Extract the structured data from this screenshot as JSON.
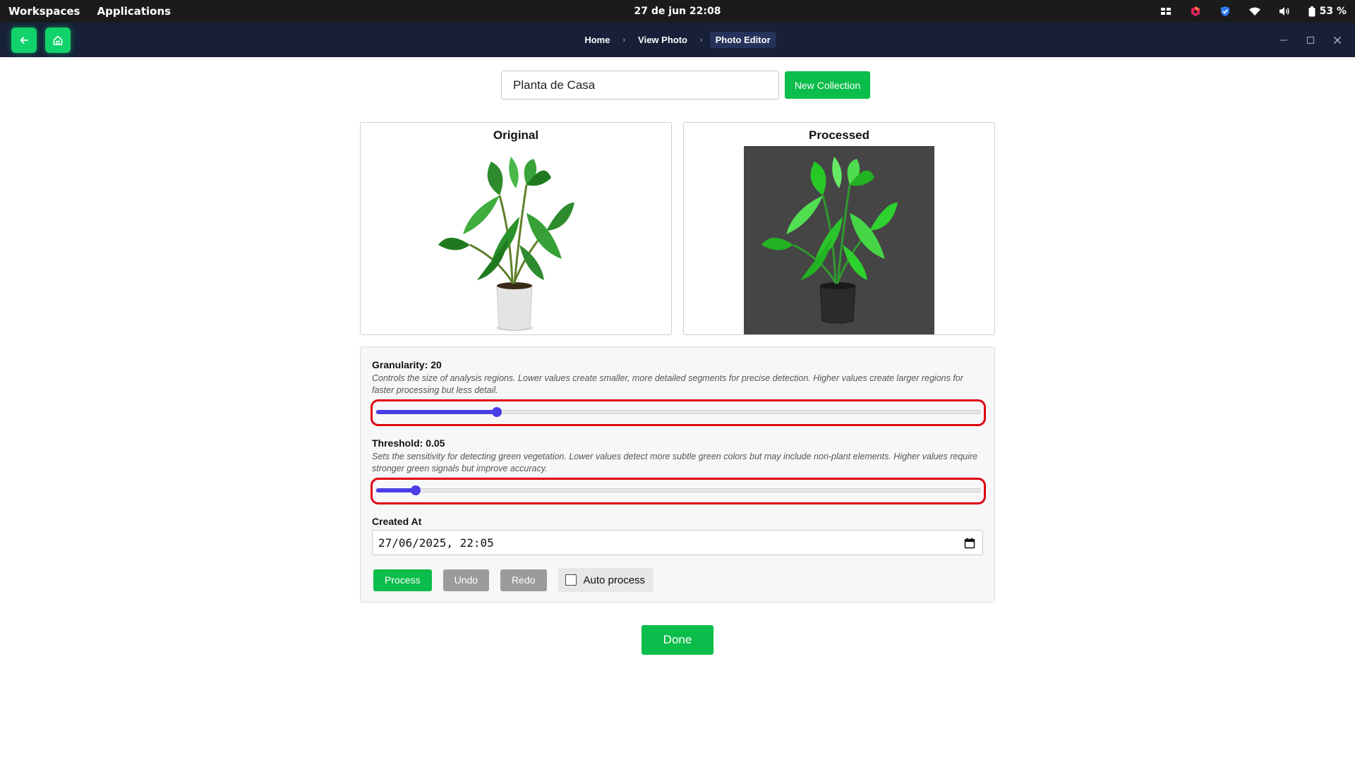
{
  "system_bar": {
    "menu": [
      "Workspaces",
      "Applications"
    ],
    "clock": "27 de jun  22:08",
    "battery": "53 %",
    "tray_icons": [
      "task-view-icon",
      "app-indicator-icon",
      "shield-icon",
      "wifi-icon",
      "volume-icon",
      "battery-icon"
    ]
  },
  "app_header": {
    "breadcrumbs": [
      "Home",
      "View Photo",
      "Photo Editor"
    ],
    "active_crumb": "Photo Editor",
    "back_icon": "arrow-left-icon",
    "home_icon": "home-icon"
  },
  "collection": {
    "name_value": "Planta de Casa",
    "new_collection_label": "New Collection"
  },
  "panels": {
    "original_title": "Original",
    "processed_title": "Processed"
  },
  "controls": {
    "granularity": {
      "label": "Granularity: 20",
      "description": "Controls the size of analysis regions. Lower values create smaller, more detailed segments for precise detection. Higher values create larger regions for faster processing but less detail.",
      "value_fraction": 0.2
    },
    "threshold": {
      "label": "Threshold: 0.05",
      "description": "Sets the sensitivity for detecting green vegetation. Lower values detect more subtle green colors but may include non-plant elements. Higher values require stronger green signals but improve accuracy.",
      "value_fraction": 0.065
    },
    "created_at": {
      "label": "Created At",
      "value": "27/06/2025, 22:05"
    },
    "buttons": {
      "process": "Process",
      "undo": "Undo",
      "redo": "Redo",
      "auto_process": "Auto process"
    },
    "auto_process_checked": false
  },
  "done_label": "Done",
  "colors": {
    "accent_green": "#0bbd4a",
    "nav_green": "#12d36b",
    "slider_blue": "#4a3ee6",
    "highlight_red": "#e00012",
    "header_bg": "#172038"
  }
}
